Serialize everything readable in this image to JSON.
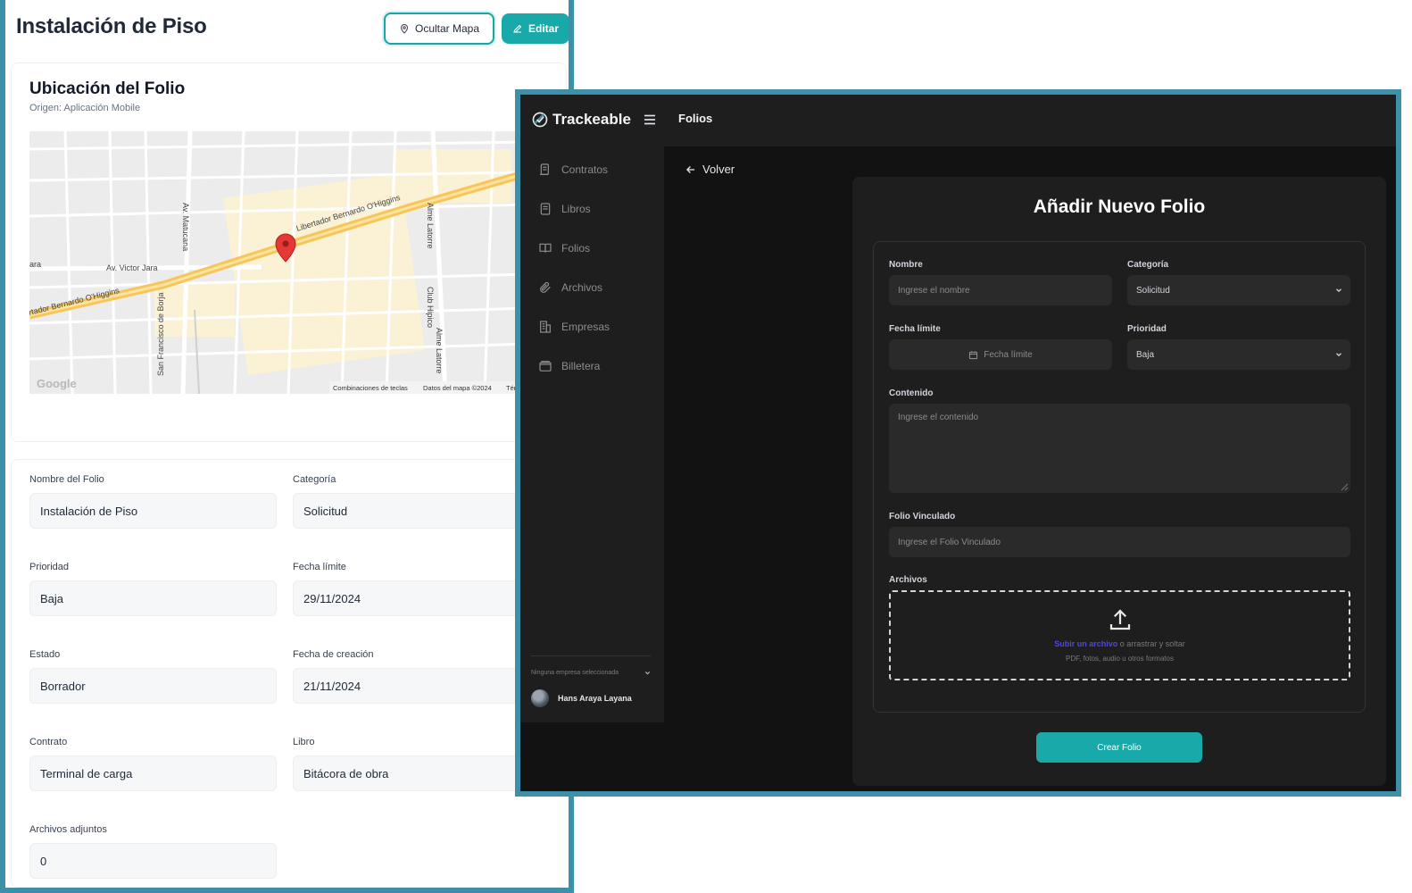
{
  "folio_view": {
    "title": "Instalación de Piso",
    "buttons": {
      "hide_map": "Ocultar Mapa",
      "edit": "Editar"
    },
    "location": {
      "title": "Ubicación del Folio",
      "origin": "Origen: Aplicación Mobile",
      "map": {
        "streets": [
          "Libertador Bernardo O'Higgins",
          "rtador Bernardo O'Higgins",
          "Av. Victor Jara",
          "ara",
          "Av. Matucana",
          "San Francisco de Borja",
          "Alme Latorre",
          "Alme Latorre",
          "Club Hipico"
        ],
        "brand": "Google",
        "attribution": [
          "Combinaciones de teclas",
          "Datos del mapa ©2024",
          "Tér"
        ]
      }
    },
    "fields": [
      {
        "label": "Nombre del Folio",
        "value": "Instalación de Piso"
      },
      {
        "label": "Categoría",
        "value": "Solicitud"
      },
      {
        "label": "Prioridad",
        "value": "Baja"
      },
      {
        "label": "Fecha límite",
        "value": "29/11/2024"
      },
      {
        "label": "Estado",
        "value": "Borrador"
      },
      {
        "label": "Fecha de creación",
        "value": "21/11/2024"
      },
      {
        "label": "Contrato",
        "value": "Terminal de carga"
      },
      {
        "label": "Libro",
        "value": "Bitácora de obra"
      },
      {
        "label": "Archivos adjuntos",
        "value": "0"
      }
    ]
  },
  "app": {
    "brand": "Trackeable",
    "topbar_title": "Folios",
    "nav": [
      {
        "label": "Contratos",
        "icon": "scroll-icon"
      },
      {
        "label": "Libros",
        "icon": "book-icon"
      },
      {
        "label": "Folios",
        "icon": "open-book-icon"
      },
      {
        "label": "Archivos",
        "icon": "paperclip-icon"
      },
      {
        "label": "Empresas",
        "icon": "building-icon"
      },
      {
        "label": "Billetera",
        "icon": "wallet-icon"
      }
    ],
    "company_select": "Ninguna empresa seleccionada",
    "user_name": "Hans Araya Layana",
    "back": "Volver",
    "form": {
      "title": "Añadir Nuevo Folio",
      "nombre_label": "Nombre",
      "nombre_placeholder": "Ingrese el nombre",
      "categoria_label": "Categoría",
      "categoria_value": "Solicitud",
      "fecha_label": "Fecha límite",
      "fecha_button": "Fecha límite",
      "prioridad_label": "Prioridad",
      "prioridad_value": "Baja",
      "contenido_label": "Contenido",
      "contenido_placeholder": "Ingrese el contenido",
      "vinculado_label": "Folio Vinculado",
      "vinculado_placeholder": "Ingrese el Folio Vinculado",
      "archivos_label": "Archivos",
      "upload_link": "Subir un archivo",
      "upload_rest": " o arrastrar y soltar",
      "upload_hint": "PDF, fotos, audio u otros formatos",
      "submit": "Crear Folio"
    }
  },
  "colors": {
    "accent": "#19a9a9",
    "frame": "#3e8fa8",
    "map_road": "#f6c65b",
    "map_pin": "#e53935",
    "upload_link": "#4f46e5"
  }
}
